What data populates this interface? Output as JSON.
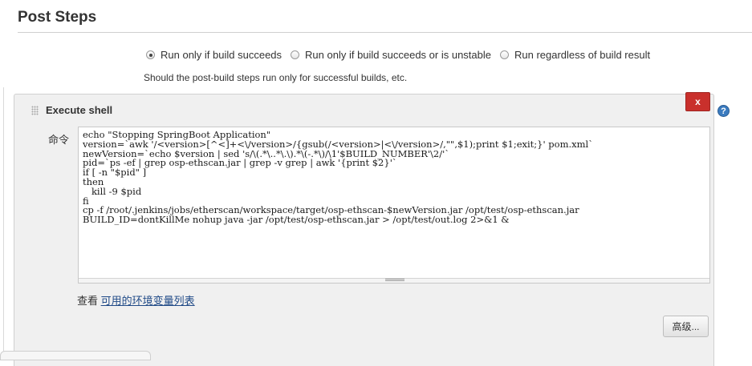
{
  "header": {
    "title": "Post Steps"
  },
  "post_steps": {
    "options": [
      {
        "label": "Run only if build succeeds",
        "checked": true
      },
      {
        "label": "Run only if build succeeds or is unstable",
        "checked": false
      },
      {
        "label": "Run regardless of build result",
        "checked": false
      }
    ],
    "help_note": "Should the post-build steps run only for successful builds, etc."
  },
  "shell_step": {
    "title": "Execute shell",
    "delete_label": "x",
    "help_label": "?",
    "command_label": "命令",
    "script_lines": [
      "echo \"Stopping SpringBoot Application\"",
      "version=`awk '/<version>[^<]+<\\/version>/{gsub(/<version>|<\\/version>/,\"\",$1);print $1;exit;}' pom.xml`",
      "newVersion=`echo $version | sed 's/\\(.*\\..*\\.\\).*\\(-.*\\)/\\1'$BUILD_NUMBER'\\2/'`",
      "pid=`ps -ef | grep osp-ethscan.jar | grep -v grep | awk '{print $2}'`",
      "if [ -n \"$pid\" ]",
      "then",
      "   kill -9 $pid",
      "fi",
      "cp -f /root/.jenkins/jobs/etherscan/workspace/target/osp-ethscan-$newVersion.jar /opt/test/osp-ethscan.jar",
      "BUILD_ID=dontKillMe nohup java -jar /opt/test/osp-ethscan.jar > /opt/test/out.log 2>&1 &"
    ],
    "env_prefix": "查看",
    "env_link": "可用的环境变量列表",
    "advanced_label": "高级..."
  },
  "colors": {
    "delete_button": "#c9302c",
    "help_icon": "#3b7bbf",
    "link": "#204a87"
  },
  "icons": [
    "drag-handle-icon",
    "help-icon",
    "radio-icon"
  ]
}
